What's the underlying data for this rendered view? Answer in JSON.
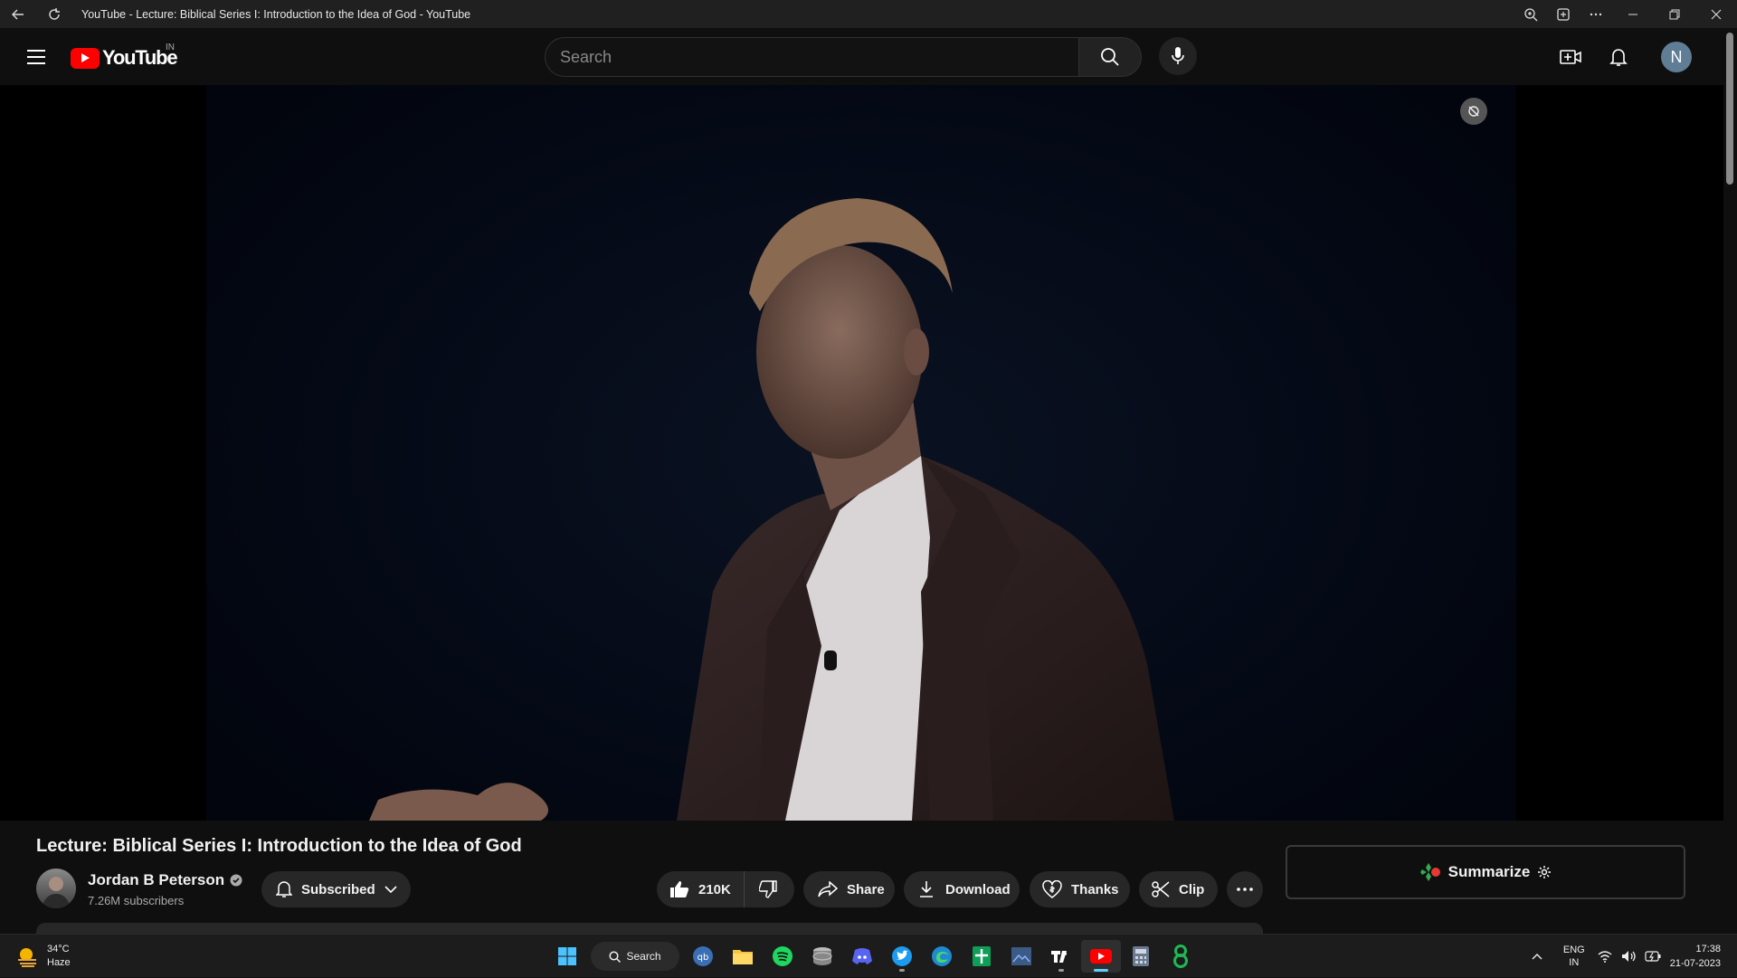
{
  "browser": {
    "tab_title": "YouTube - Lecture: Biblical Series I: Introduction to the Idea of God - YouTube"
  },
  "masthead": {
    "logo_text": "YouTube",
    "region": "IN",
    "search_placeholder": "Search",
    "avatar_initial": "N"
  },
  "video": {
    "title": "Lecture: Biblical Series I: Introduction to the Idea of God"
  },
  "channel": {
    "name": "Jordan B Peterson",
    "subscribers": "7.26M subscribers",
    "subscribe_label": "Subscribed"
  },
  "actions": {
    "likes": "210K",
    "share": "Share",
    "download": "Download",
    "thanks": "Thanks",
    "clip": "Clip"
  },
  "extension": {
    "summarize_label": "Summarize"
  },
  "taskbar": {
    "weather_temp": "34°C",
    "weather_desc": "Haze",
    "search_label": "Search",
    "lang_primary": "ENG",
    "lang_secondary": "IN",
    "time": "17:38",
    "date": "21-07-2023"
  },
  "colors": {
    "youtube_red": "#ff0000",
    "background": "#0f0f0f",
    "pill": "#272727"
  }
}
